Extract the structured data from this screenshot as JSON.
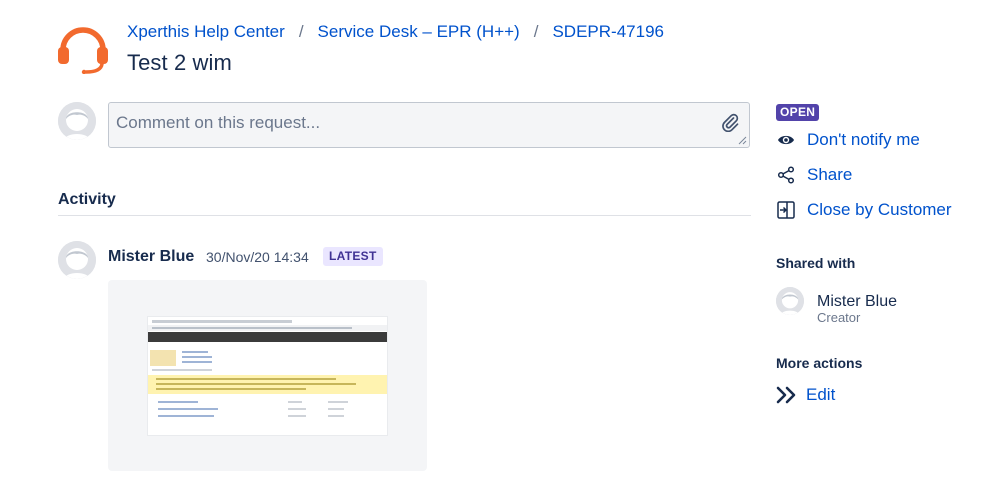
{
  "breadcrumb": {
    "items": [
      "Xperthis Help Center",
      "Service Desk – EPR (H++)",
      "SDEPR-47196"
    ],
    "separator": "/"
  },
  "request": {
    "title": "Test 2 wim"
  },
  "comment": {
    "placeholder": "Comment on this request..."
  },
  "activity": {
    "heading": "Activity",
    "entry": {
      "author": "Mister Blue",
      "timestamp": "30/Nov/20 14:34",
      "badge": "LATEST"
    }
  },
  "sidebar": {
    "status": "OPEN",
    "actions": {
      "notify": "Don't notify me",
      "share": "Share",
      "close": "Close by Customer"
    },
    "shared_with": {
      "heading": "Shared with",
      "name": "Mister Blue",
      "role": "Creator"
    },
    "more_actions": {
      "heading": "More actions",
      "edit": "Edit"
    }
  },
  "icons": {
    "logo": "headset-icon",
    "attach": "paperclip-icon",
    "notify": "eye-icon",
    "share": "share-icon",
    "close": "close-request-icon",
    "edit": "double-chevron-right-icon"
  },
  "colors": {
    "link": "#0052CC",
    "text": "#172B4D",
    "brand_orange": "#F26A2E",
    "status_open": "#5243AA",
    "badge_latest_bg": "#EAE6FF",
    "badge_latest_text": "#403294"
  }
}
